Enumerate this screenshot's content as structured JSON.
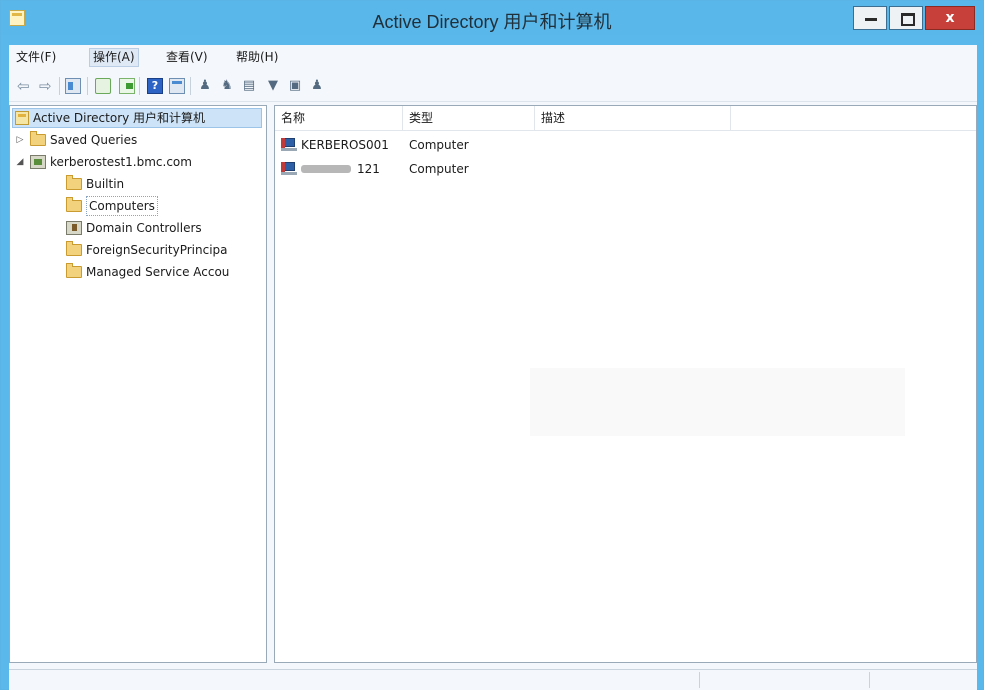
{
  "window": {
    "title": "Active Directory 用户和计算机",
    "close_label": "x"
  },
  "menu": {
    "items": [
      "文件(F)",
      "操作(A)",
      "查看(V)",
      "帮助(H)"
    ]
  },
  "toolbar": {
    "icons": [
      "back-arrow-icon",
      "forward-arrow-icon",
      "show-tree-icon",
      "refresh-icon",
      "export-list-icon",
      "help-icon",
      "show-action-pane-icon",
      "new-user-icon",
      "new-group-icon",
      "new-ou-icon",
      "filter-icon",
      "find-icon",
      "delegate-control-icon"
    ],
    "help_glyph": "?"
  },
  "tree": {
    "root_label": "Active Directory 用户和计算机",
    "items": [
      {
        "label": "Saved Queries",
        "expander": "▷"
      },
      {
        "label": "kerberostest1.bmc.com",
        "expander": "◢"
      },
      {
        "label": "Builtin"
      },
      {
        "label": "Computers"
      },
      {
        "label": "Domain Controllers"
      },
      {
        "label": "ForeignSecurityPrincipa"
      },
      {
        "label": "Managed Service Accou"
      }
    ]
  },
  "scrollbar": {
    "left_arrow": "<",
    "right_arrow": ">",
    "grip": "III"
  },
  "list": {
    "columns": [
      "名称",
      "类型",
      "描述"
    ],
    "rows": [
      {
        "name": "KERBEROS001",
        "type": "Computer",
        "description": ""
      },
      {
        "name": "121",
        "type": "Computer",
        "description": ""
      }
    ]
  },
  "colors": {
    "title_bar": "#5ab7ea",
    "close_button": "#c7413a",
    "selection": "#cde3f7"
  }
}
